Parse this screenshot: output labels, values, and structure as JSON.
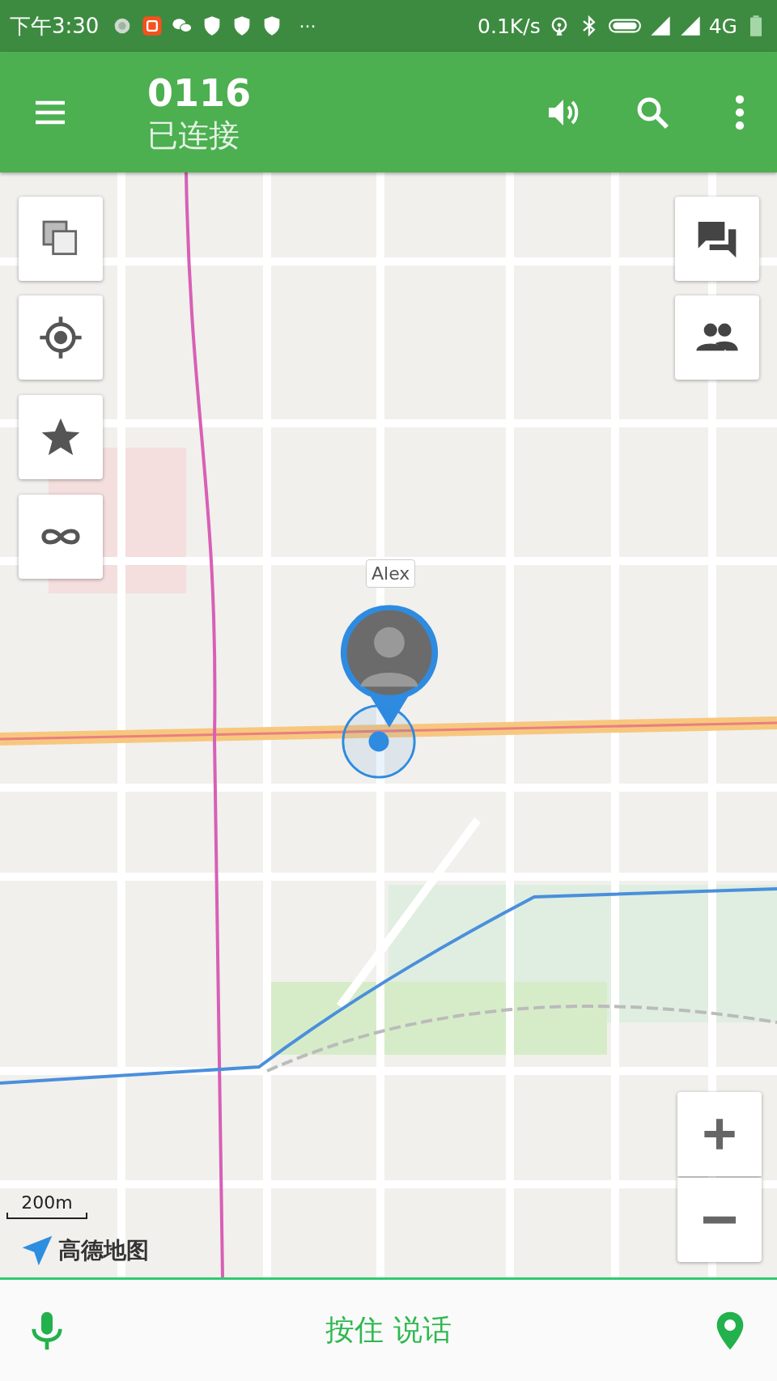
{
  "status_bar": {
    "time": "下午3:30",
    "more": "···",
    "net_speed": "0.1K/s",
    "network": "4G"
  },
  "toolbar": {
    "title": "0116",
    "subtitle": "已连接"
  },
  "map": {
    "marker": {
      "label": "Alex"
    },
    "scale": "200m",
    "attribution": "高德地图"
  },
  "bottom_bar": {
    "talk_button": "按住 说话"
  }
}
